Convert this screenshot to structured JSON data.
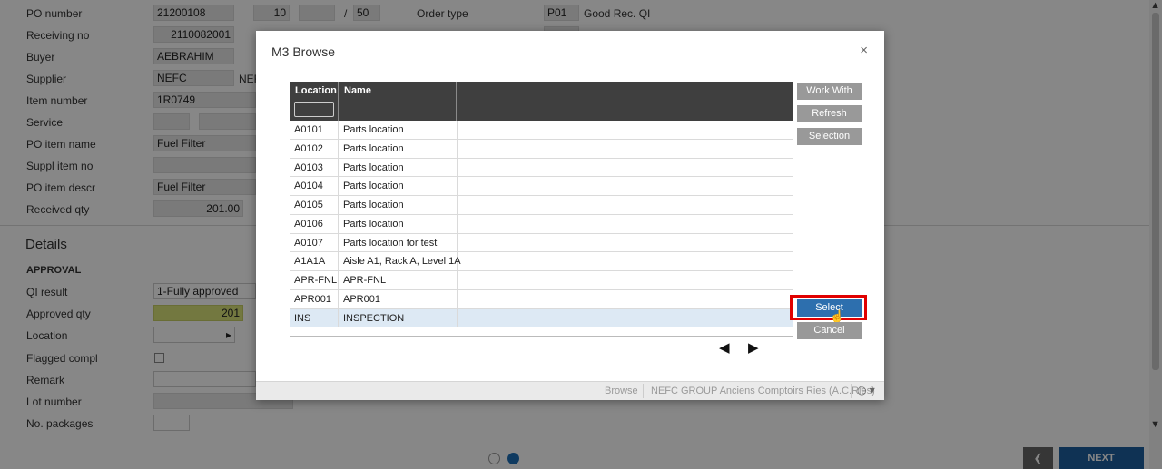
{
  "form": {
    "po_number_label": "PO number",
    "po_number": "21200108",
    "po_line": "10",
    "po_sub": "",
    "slash": "/",
    "po_qty": "50",
    "order_type_label": "Order type",
    "order_type_code": "P01",
    "order_type_desc": "Good Rec. QI",
    "receiving_no_label": "Receiving no",
    "receiving_no": "2110082001",
    "buyer_label": "Buyer",
    "buyer": "AEBRAHIM",
    "supplier_label": "Supplier",
    "supplier": "NEFC",
    "supplier_name": "NEF",
    "item_number_label": "Item number",
    "item_number": "1R0749",
    "service_label": "Service",
    "po_item_name_label": "PO item name",
    "po_item_name": "Fuel Filter",
    "suppl_item_no_label": "Suppl item no",
    "po_item_descr_label": "PO item descr",
    "po_item_descr": "Fuel Filter",
    "received_qty_label": "Received qty",
    "received_qty": "201.00"
  },
  "details": {
    "title": "Details",
    "section": "APPROVAL",
    "qi_result_label": "QI result",
    "qi_result": "1-Fully approved",
    "approved_qty_label": "Approved qty",
    "approved_qty": "201",
    "location_label": "Location",
    "location_arrow": "▸",
    "flagged_compl_label": "Flagged compl",
    "remark_label": "Remark",
    "lot_number_label": "Lot number",
    "no_packages_label": "No. packages"
  },
  "nav": {
    "back_icon": "chevron-left-icon",
    "back_glyph": "❮",
    "next_label": "NEXT",
    "step": 2,
    "steps": 2
  },
  "scrollbar": {
    "up": "▲",
    "down": "▼"
  },
  "dialog": {
    "title": "M3 Browse",
    "close_glyph": "×",
    "columns": [
      "Location",
      "Name"
    ],
    "rows": [
      {
        "loc": "A0101",
        "name": "Parts location"
      },
      {
        "loc": "A0102",
        "name": "Parts location"
      },
      {
        "loc": "A0103",
        "name": "Parts location"
      },
      {
        "loc": "A0104",
        "name": "Parts location"
      },
      {
        "loc": "A0105",
        "name": "Parts location"
      },
      {
        "loc": "A0106",
        "name": "Parts location"
      },
      {
        "loc": "A0107",
        "name": "Parts location for test"
      },
      {
        "loc": "A1A1A",
        "name": "Aisle A1, Rack A, Level 1A"
      },
      {
        "loc": "APR-FNL",
        "name": "APR-FNL"
      },
      {
        "loc": "APR001",
        "name": "APR001"
      },
      {
        "loc": "INS",
        "name": "INSPECTION"
      }
    ],
    "selected_row": 10,
    "buttons": {
      "work_with": "Work With",
      "refresh": "Refresh",
      "selection": "Selection",
      "select": "Select",
      "cancel": "Cancel"
    },
    "pager": {
      "prev_glyph": "◀",
      "next_glyph": "▶"
    },
    "status": {
      "program": "Browse",
      "company": "NEFC GROUP Anciens Comptoirs Ries (A.C.Ries)",
      "clock_icon": "clock-icon",
      "clock_glyph": "◷ ▾"
    }
  },
  "colors": {
    "accent": "#1e5f9f",
    "select_button": "#2d6fae",
    "highlight_border": "#e00000",
    "grid_header": "#3f3f3f",
    "selected_row": "#dde9f4",
    "approved_qty_bg": "#d9e27a"
  }
}
